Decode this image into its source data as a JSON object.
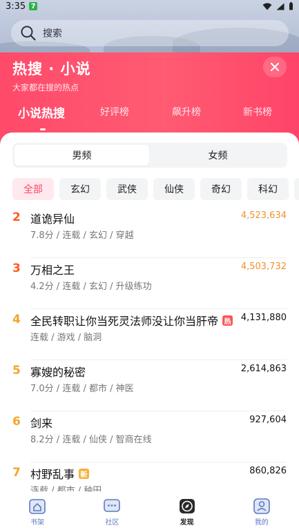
{
  "status_bar": {
    "time": "3:35",
    "app_badge": "7"
  },
  "search": {
    "placeholder": "搜索"
  },
  "header": {
    "title": "热搜 · 小说",
    "subtitle": "大家都在搜的热点"
  },
  "tabs": [
    {
      "label": "小说热搜",
      "active": true
    },
    {
      "label": "好评榜",
      "active": false
    },
    {
      "label": "飙升榜",
      "active": false
    },
    {
      "label": "新书榜",
      "active": false
    }
  ],
  "segment": [
    {
      "label": "男频",
      "active": true
    },
    {
      "label": "女频",
      "active": false
    }
  ],
  "categories": [
    {
      "label": "全部",
      "active": true
    },
    {
      "label": "玄幻",
      "active": false
    },
    {
      "label": "武侠",
      "active": false
    },
    {
      "label": "仙侠",
      "active": false
    },
    {
      "label": "奇幻",
      "active": false
    },
    {
      "label": "科幻",
      "active": false
    }
  ],
  "colors": {
    "accent": "#ff4a6a",
    "rank_top": "#ff5a1f",
    "rank_other": "#f4a52a",
    "count_top": "#f0912a"
  },
  "list": [
    {
      "rank": "2",
      "title": "道诡异仙",
      "meta": "7.8分 / 连载 / 玄幻 / 穿越",
      "count": "4,523,634",
      "count_hot": true,
      "badge": ""
    },
    {
      "rank": "3",
      "title": "万相之王",
      "meta": "4.2分 / 连载 / 玄幻 / 升级练功",
      "count": "4,503,732",
      "count_hot": true,
      "badge": ""
    },
    {
      "rank": "4",
      "title": "全民转职让你当死灵法师没让你当肝帝",
      "meta": "连载 / 游戏 / 脑洞",
      "count": "4,131,880",
      "count_hot": false,
      "badge": "热"
    },
    {
      "rank": "5",
      "title": "寡嫂的秘密",
      "meta": "7.0分 / 连载 / 都市 / 神医",
      "count": "2,614,863",
      "count_hot": false,
      "badge": ""
    },
    {
      "rank": "6",
      "title": "剑来",
      "meta": "8.2分 / 连载 / 仙侠 / 智商在线",
      "count": "927,604",
      "count_hot": false,
      "badge": ""
    },
    {
      "rank": "7",
      "title": "村野乱事",
      "meta": "连载 / 都市 / 种田",
      "count": "860,826",
      "count_hot": false,
      "badge": "新"
    }
  ],
  "bottom_nav": [
    {
      "label": "书架",
      "icon": "bookshelf-icon",
      "active": false
    },
    {
      "label": "社区",
      "icon": "community-icon",
      "active": false
    },
    {
      "label": "发现",
      "icon": "discover-compass-icon",
      "active": true
    },
    {
      "label": "我的",
      "icon": "profile-icon",
      "active": false
    }
  ]
}
